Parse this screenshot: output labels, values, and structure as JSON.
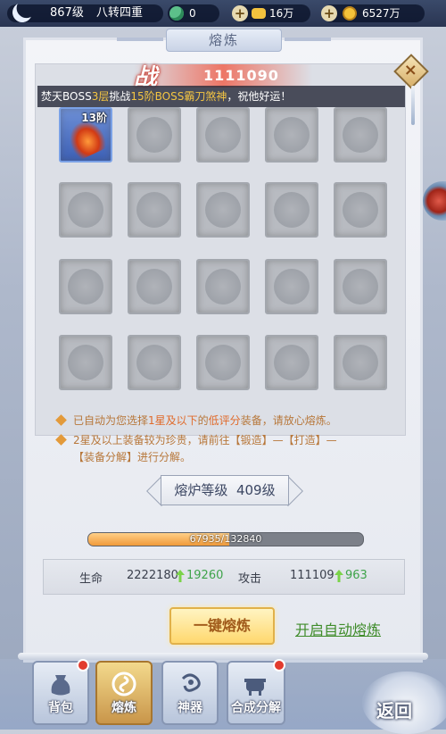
{
  "topbar": {
    "level": "867级",
    "realm": "八转四重",
    "gourd_count": "0",
    "ingot": "16万",
    "coin": "6527万"
  },
  "panel": {
    "title": "熔炼",
    "power_label": "战",
    "power_value": "1111090"
  },
  "broadcast": {
    "seg1": "焚天BOSS",
    "seg2": "3层",
    "seg3": "挑战",
    "seg4": "15阶BOSS霸刀煞神",
    "seg5": "，祝他好运！"
  },
  "item": {
    "tier": "13阶"
  },
  "tips": {
    "line1_a": "已自动为您选择",
    "line1_b": "1星及以下",
    "line1_c": "的",
    "line1_d": "低评分",
    "line1_e": "装备，请放心熔炼。",
    "line2": "2星及以上装备较为珍贵，请前往【锻造】—【打造】—",
    "line3": "【装备分解】进行分解。"
  },
  "furnace": {
    "label": "熔炉等级",
    "level": "409级"
  },
  "exp": {
    "current": 67935,
    "max": 132840,
    "text": "67935/132840"
  },
  "stats": {
    "hp_label": "生命",
    "hp_value": "2222180",
    "hp_gain": "19260",
    "atk_label": "攻击",
    "atk_value": "111109",
    "atk_gain": "963"
  },
  "actions": {
    "smelt": "一键熔炼",
    "auto": "开启自动熔炼"
  },
  "tabs": [
    "背包",
    "熔炼",
    "神器",
    "合成分解"
  ],
  "back": "返回"
}
